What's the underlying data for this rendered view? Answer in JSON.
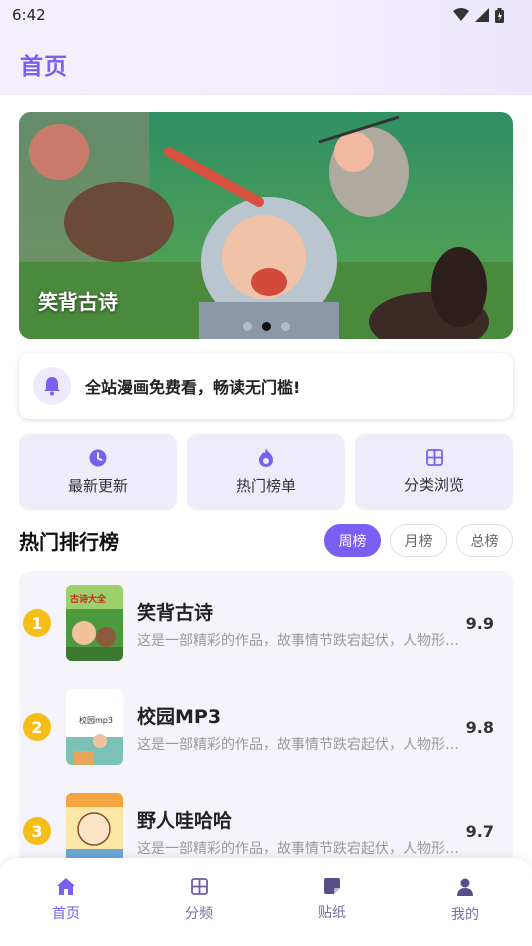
{
  "status_bar": {
    "time": "6:42"
  },
  "header": {
    "title": "首页"
  },
  "banner": {
    "title": "笑背古诗",
    "slides": 3,
    "active_slide": 2
  },
  "notice": {
    "text": "全站漫画免费看，畅读无门槛!"
  },
  "quick_actions": [
    {
      "label": "最新更新",
      "icon": "clock-icon"
    },
    {
      "label": "热门榜单",
      "icon": "flame-icon"
    },
    {
      "label": "分类浏览",
      "icon": "grid-icon"
    }
  ],
  "ranking": {
    "title": "热门排行榜",
    "tabs": [
      {
        "label": "周榜",
        "active": true
      },
      {
        "label": "月榜",
        "active": false
      },
      {
        "label": "总榜",
        "active": false
      }
    ],
    "items": [
      {
        "rank": "1",
        "name": "笑背古诗",
        "desc": "这是一部精彩的作品，故事情节跌宕起伏，人物形象鲜明",
        "score": "9.9",
        "cover_text": "古诗大全"
      },
      {
        "rank": "2",
        "name": "校园MP3",
        "desc": "这是一部精彩的作品，故事情节跌宕起伏，人物形象鲜明",
        "score": "9.8",
        "cover_text": "校园mp3"
      },
      {
        "rank": "3",
        "name": "野人哇哈哈",
        "desc": "这是一部精彩的作品，故事情节跌宕起伏，人物形象鲜明",
        "score": "9.7",
        "cover_text": ""
      }
    ]
  },
  "bottom_nav": [
    {
      "label": "首页",
      "icon": "home-icon",
      "active": true
    },
    {
      "label": "分频",
      "icon": "grid-icon",
      "active": false
    },
    {
      "label": "贴纸",
      "icon": "sticker-icon",
      "active": false
    },
    {
      "label": "我的",
      "icon": "person-icon",
      "active": false
    }
  ],
  "colors": {
    "accent": "#7b5ef2",
    "rank_badge": "#f6bd16",
    "card_bg": "#eeebfa"
  }
}
